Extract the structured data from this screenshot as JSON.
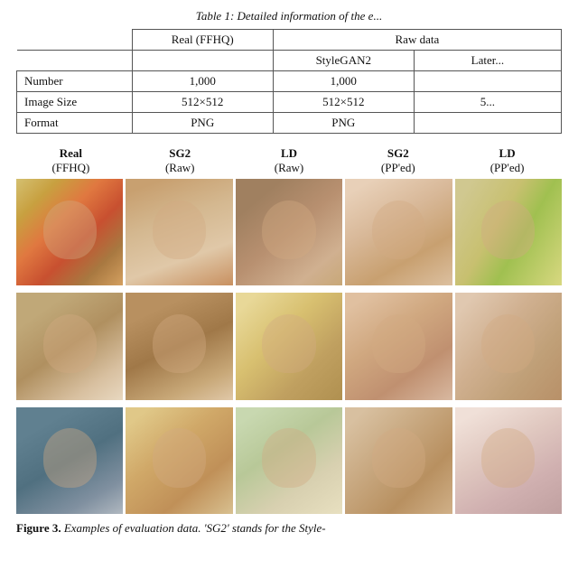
{
  "table": {
    "title": "Table 1: Detailed information of the e...",
    "header_row1": [
      "",
      "Real (FFHQ)",
      "Raw data"
    ],
    "header_row2": [
      "",
      "",
      "StyleGAN2",
      "Later..."
    ],
    "rows": [
      {
        "label": "Number",
        "real": "1,000",
        "sg2": "1,000",
        "lat": ""
      },
      {
        "label": "Image Size",
        "real": "512×512",
        "sg2": "512×512",
        "lat": "5..."
      },
      {
        "label": "Format",
        "real": "PNG",
        "sg2": "PNG",
        "lat": ""
      }
    ]
  },
  "columns": [
    {
      "title": "Real",
      "subtitle": "(FFHQ)"
    },
    {
      "title": "SG2",
      "subtitle": "(Raw)"
    },
    {
      "title": "LD",
      "subtitle": "(Raw)"
    },
    {
      "title": "SG2",
      "subtitle": "(PP'ed)"
    },
    {
      "title": "LD",
      "subtitle": "(PP'ed)"
    }
  ],
  "caption": {
    "prefix": "Figure 3.",
    "text": " Examples of evaluation data. 'SG2' stands for the Style-"
  }
}
